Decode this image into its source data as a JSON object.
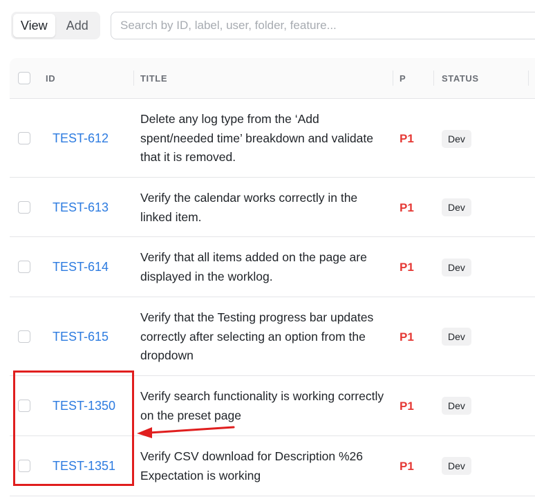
{
  "toolbar": {
    "view_label": "View",
    "add_label": "Add",
    "search_placeholder": "Search by ID, label, user, folder, feature..."
  },
  "table": {
    "columns": {
      "id": "ID",
      "title": "TITLE",
      "priority": "P",
      "status": "STATUS"
    },
    "rows": [
      {
        "id": "TEST-612",
        "title": "Delete any log type from the ‘Add spent/needed time’ breakdown and validate that it is removed.",
        "priority": "P1",
        "status": "Dev"
      },
      {
        "id": "TEST-613",
        "title": "Verify the calendar works correctly in the linked item.",
        "priority": "P1",
        "status": "Dev"
      },
      {
        "id": "TEST-614",
        "title": "Verify that all items added on the page are displayed in the worklog.",
        "priority": "P1",
        "status": "Dev"
      },
      {
        "id": "TEST-615",
        "title": "Verify that the Testing progress bar updates correctly after selecting an option from the dropdown",
        "priority": "P1",
        "status": "Dev"
      },
      {
        "id": "TEST-1350",
        "title": "Verify search functionality is working correctly on the preset page",
        "priority": "P1",
        "status": "Dev"
      },
      {
        "id": "TEST-1351",
        "title": "Verify CSV download for Description %26 Expectation is working",
        "priority": "P1",
        "status": "Dev"
      }
    ]
  },
  "colors": {
    "link": "#2c7be0",
    "priority": "#e53935",
    "annotation": "#e01e1e",
    "header_bg": "#fafafa",
    "border": "#e4e5e8"
  }
}
